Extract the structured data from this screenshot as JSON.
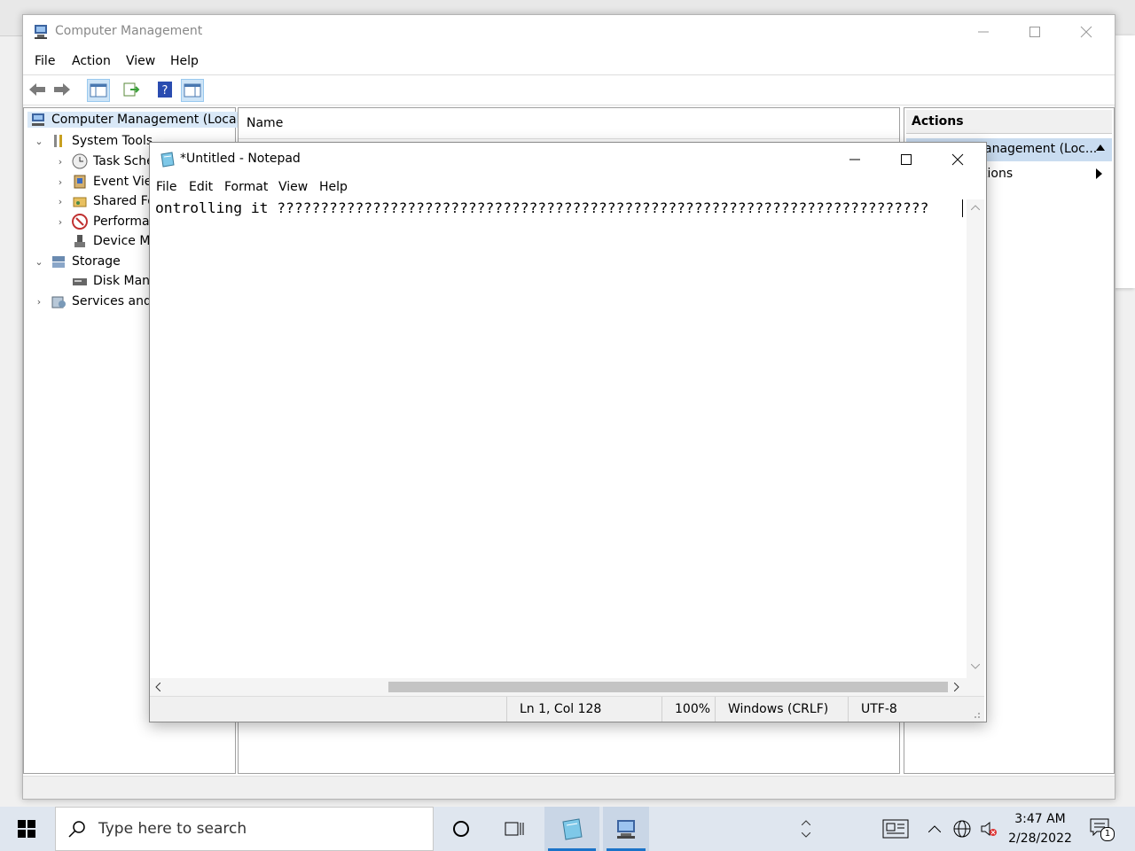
{
  "cm": {
    "title": "Computer Management",
    "menu": [
      "File",
      "Action",
      "View",
      "Help"
    ],
    "tree": {
      "root": "Computer Management (Local)",
      "system_tools": "System Tools",
      "task_scheduler": "Task Sche",
      "event_viewer": "Event Viev",
      "shared_folders": "Shared Fo",
      "performance": "Performar",
      "device_manager": "Device Ma",
      "storage": "Storage",
      "disk_management": "Disk Mana",
      "services": "Services and A"
    },
    "center_header": "Name",
    "actions": {
      "header": "Actions",
      "item_selected": "anagement (Loc...",
      "item_more": "tions"
    }
  },
  "notepad": {
    "title": "*Untitled - Notepad",
    "menu": [
      "File",
      "Edit",
      "Format",
      "View",
      "Help"
    ],
    "text": "ontrolling it ???????????????????????????????????????????????????????????????????????????",
    "status": {
      "position": "Ln 1, Col 128",
      "zoom": "100%",
      "line_ending": "Windows (CRLF)",
      "encoding": "UTF-8"
    }
  },
  "taskbar": {
    "search_placeholder": "Type here to search",
    "time": "3:47 AM",
    "date": "2/28/2022",
    "notification_count": "1"
  },
  "colors": {
    "selection": "#c9dcf0",
    "taskbar": "#dfe6ef",
    "accent": "#1a73c8"
  }
}
